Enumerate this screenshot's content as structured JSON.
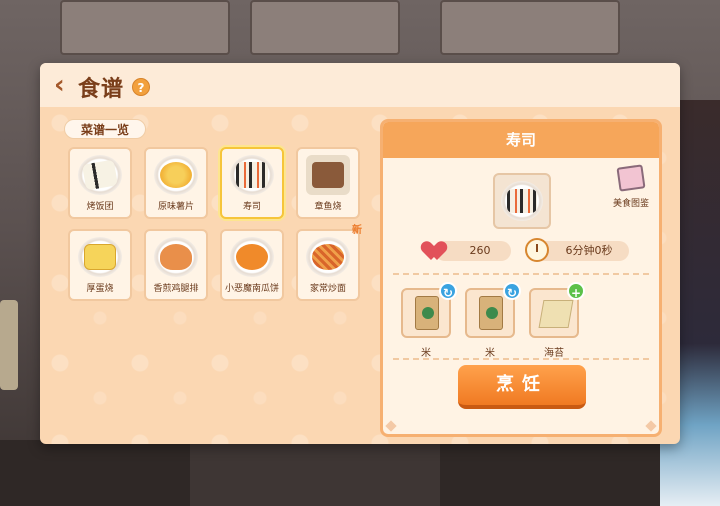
{
  "header": {
    "title": "食谱",
    "back_icon": "chevron-left-icon",
    "help_label": "?"
  },
  "recipe_list": {
    "label": "菜谱一览",
    "items": [
      {
        "name": "烤饭团",
        "icon": "onigiri-icon",
        "selected": false,
        "new": false
      },
      {
        "name": "原味薯片",
        "icon": "chips-icon",
        "selected": false,
        "new": false
      },
      {
        "name": "寿司",
        "icon": "sushi-icon",
        "selected": true,
        "new": false
      },
      {
        "name": "章鱼烧",
        "icon": "takoyaki-icon",
        "selected": false,
        "new": false
      },
      {
        "name": "厚蛋烧",
        "icon": "tamagoyaki-icon",
        "selected": false,
        "new": false
      },
      {
        "name": "香煎鸡腿排",
        "icon": "chicken-leg-icon",
        "selected": false,
        "new": false
      },
      {
        "name": "小恶魔南瓜饼",
        "icon": "pumpkin-cake-icon",
        "selected": false,
        "new": false
      },
      {
        "name": "家常炒面",
        "icon": "fried-noodles-icon",
        "selected": false,
        "new": true
      }
    ],
    "new_label": "新"
  },
  "detail": {
    "title": "寿司",
    "guide_label": "美食图鉴",
    "hp_value": "260",
    "time_value": "6分钟0秒",
    "ingredients": [
      {
        "name": "米",
        "icon": "rice-bag-icon",
        "badge": "swap"
      },
      {
        "name": "米",
        "icon": "rice-bag-icon",
        "badge": "swap"
      },
      {
        "name": "海苔",
        "icon": "seaweed-icon",
        "badge": "add"
      }
    ],
    "cook_label": "烹饪"
  },
  "colors": {
    "panel_bg": "#fbd7b2",
    "accent_orange": "#f6a65a",
    "selected_border": "#f6c53a",
    "text_brown": "#7a3e1a"
  }
}
